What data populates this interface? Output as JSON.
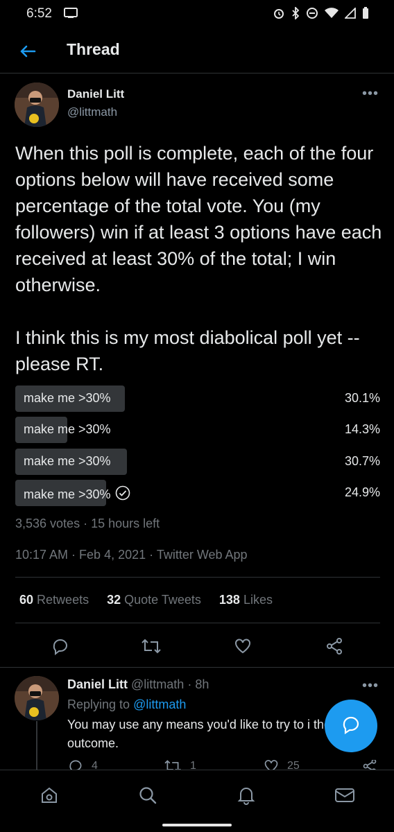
{
  "status_bar": {
    "time": "6:52"
  },
  "header": {
    "title": "Thread"
  },
  "tweet": {
    "author_name": "Daniel Litt",
    "author_handle": "@littmath",
    "text": "When this poll is complete, each of the four options below will have received some percentage of the total vote. You (my followers) win if at least 3 options have each received at least 30% of the total; I win otherwise.\n\nI think this is my most diabolical poll yet -- please RT.",
    "poll": {
      "options": [
        {
          "label": "make me >30%",
          "percent_text": "30.1%",
          "percent": 30.1,
          "selected": false
        },
        {
          "label": "make me >30%",
          "percent_text": "14.3%",
          "percent": 14.3,
          "selected": false
        },
        {
          "label": "make me >30%",
          "percent_text": "30.7%",
          "percent": 30.7,
          "selected": false
        },
        {
          "label": "make me >30%",
          "percent_text": "24.9%",
          "percent": 24.9,
          "selected": true
        }
      ],
      "votes": "3,536 votes",
      "time_left": "15 hours left"
    },
    "timestamp": "10:17 AM · Feb 4, 2021",
    "source": "Twitter Web App",
    "stats": {
      "retweets_count": "60",
      "retweets_label": "Retweets",
      "quotes_count": "32",
      "quotes_label": "Quote Tweets",
      "likes_count": "138",
      "likes_label": "Likes"
    }
  },
  "reply": {
    "author_name": "Daniel Litt",
    "author_handle": "@littmath",
    "age": "8h",
    "replying_prefix": "Replying to",
    "replying_to": "@littmath",
    "text": "You may use any means you'd like to try to i the outcome.",
    "reply_count": "4",
    "retweet_count": "1",
    "like_count": "25"
  },
  "colors": {
    "accent": "#1d9bf0",
    "background": "#000000",
    "poll_bar": "#333639"
  }
}
